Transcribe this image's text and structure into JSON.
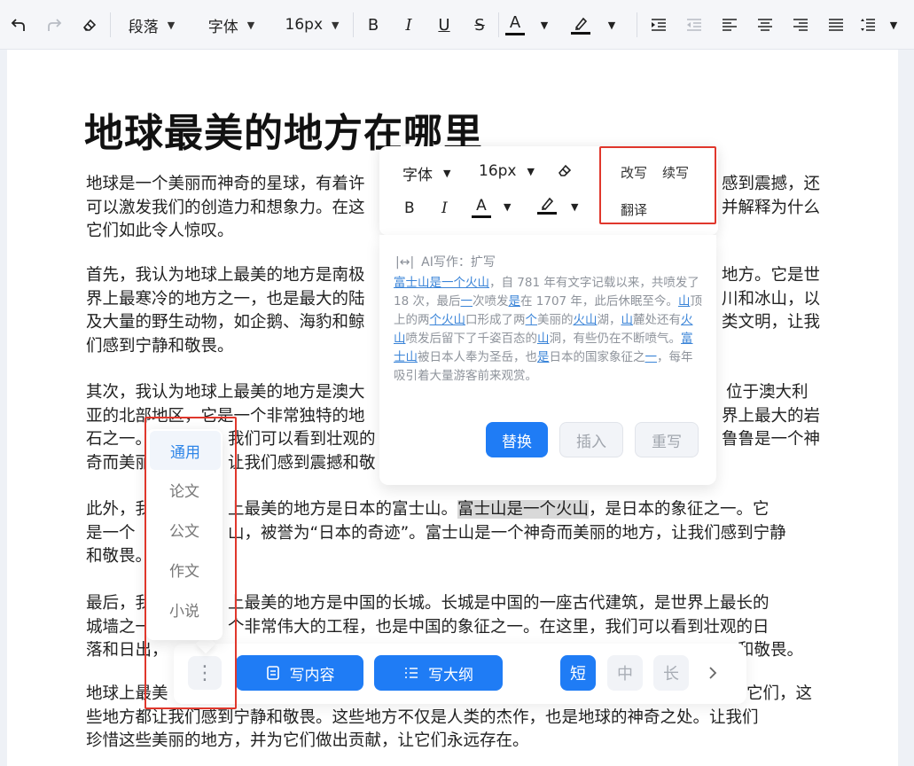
{
  "toolbar": {
    "undo_icon": "undo-icon",
    "redo_icon": "redo-icon",
    "eraser_icon": "eraser-icon",
    "paragraph": "段落",
    "font": "字体",
    "size": "16px",
    "bold": "B",
    "italic": "I",
    "underline": "U",
    "strike": "S",
    "font_color": "A",
    "highlight_icon": "highlighter-icon",
    "accent": "#1f7cf5"
  },
  "doc": {
    "title": "地球最美的地方在哪里",
    "paragraphs": [
      [
        "地球是一个美丽而神奇的星球，有着许",
        "感到震撼，还"
      ],
      [
        "可以激发我们的创造力和想象力。在这",
        "并解释为什么"
      ],
      [
        "它们如此令人惊叹。"
      ]
    ],
    "p1_line1_a": "地球是一个美丽而神奇的星球，有着许",
    "p1_line1_b": "感到震撼，还",
    "p1_line2_a": "可以激发我们的创造力和想象力。在这",
    "p1_line2_b": "并解释为什么",
    "p1_line3": "它们如此令人惊叹。",
    "p2_line1_a": "首先，我认为地球上最美的地方是南极",
    "p2_line1_b": "地方。它是世",
    "p2_line2_a": "界上最寒冷的地方之一，也是最大的陆",
    "p2_line2_b": "川和冰山，以",
    "p2_line3_a": "及大量的野生动物，如企鹅、海豹和鲸",
    "p2_line3_b": "类文明，让我",
    "p2_line4": "们感到宁静和敬畏。",
    "p3_line1_a": "其次，我认为地球上最美的地方是澳大",
    "p3_line1_b": "位于澳大利",
    "p3_line2_a": "亚的北部地区，它是一个非常独特的地",
    "p3_line2_b": "界上最大的岩",
    "p3_line3_a": "石之一。",
    "p3_line3_b": "我们可以看到壮观的",
    "p3_line3_c": "鲁鲁是一个神",
    "p3_line4_a": "奇而美丽",
    "p3_line4_b": "让我们感到震撼和敬",
    "p4_line1_a": "此外，我",
    "p4_line1_b": "上最美的地方是日本的富士山。",
    "p4_line1_hl": "富士山是一个火山",
    "p4_line1_c": "，是日本的象征之一。它",
    "p4_line2_a": "是一个",
    "p4_line2_b": "山，被誉为“日本的奇迹”。富士山是一个神奇而美丽的地方，让我们感到宁静",
    "p4_line3": "和敬畏。",
    "p5_line1_a": "最后，我",
    "p5_line1_b": "上最美的地方是中国的长城。长城是中国的一座古代建筑，是世界上最长的",
    "p5_line2_a": "城墙之一",
    "p5_line2_b": "个非常伟大的工程，也是中国的象征之一。在这里，我们可以看到壮观的日",
    "p5_line3_a": "落和日出，",
    "p5_line3_b": "和敬畏。",
    "p6_line1_a": "地球上最美",
    "p6_line1_b": "它们，这",
    "p6_line2": "些地方都让我们感到宁静和敬畏。这些地方不仅是人类的杰作，也是地球的神奇之处。让我们",
    "p6_line3": "珍惜这些美丽的地方，并为它们做出贡献，让它们永远存在。"
  },
  "floating_toolbar": {
    "font": "字体",
    "size": "16px",
    "bold": "B",
    "italic": "I",
    "font_color": "A",
    "ai_rewrite": "改写",
    "ai_continue": "续写",
    "ai_translate": "翻译"
  },
  "ai_panel": {
    "header": "AI写作：扩写",
    "t1": "富士山是一个火山",
    "t2": "，自 781 年有文字记载以来，共",
    "t3": "喷发了 18 次，最后",
    "t4": "一",
    "t5": "次喷发",
    "t6": "是",
    "t7": "在 1707 年，此后休",
    "t8": "眠至今。",
    "t9": "山",
    "t10": "顶上的两",
    "t11": "个火山",
    "t12": "口形成了两",
    "t13": "个",
    "t14": "美丽的",
    "t15": "火山",
    "t16": "湖，",
    "t17": "山",
    "t18": "麓处还有",
    "t19": "火山",
    "t20": "喷发后留下了千姿百态的",
    "t21": "山",
    "t22": "洞，",
    "t23": "有些仍在不断喷气。",
    "t24": "富士山",
    "t25": "被日本人奉为圣岳，也",
    "t26": "是",
    "t27": "日本的国家象征之",
    "t28": "一",
    "t29": "，每年吸引着大量游客前来观",
    "t30": "赏。",
    "replace": "替换",
    "insert": "插入",
    "rewrite": "重写"
  },
  "type_menu": {
    "items": [
      "通用",
      "论文",
      "公文",
      "作文",
      "小说"
    ],
    "selected": "通用"
  },
  "bottom_bar": {
    "write_content": "写内容",
    "write_outline": "写大纲",
    "short": "短",
    "medium": "中",
    "long": "长",
    "next_icon": "chevron-right-icon",
    "more_icon": "more-vertical-icon"
  }
}
